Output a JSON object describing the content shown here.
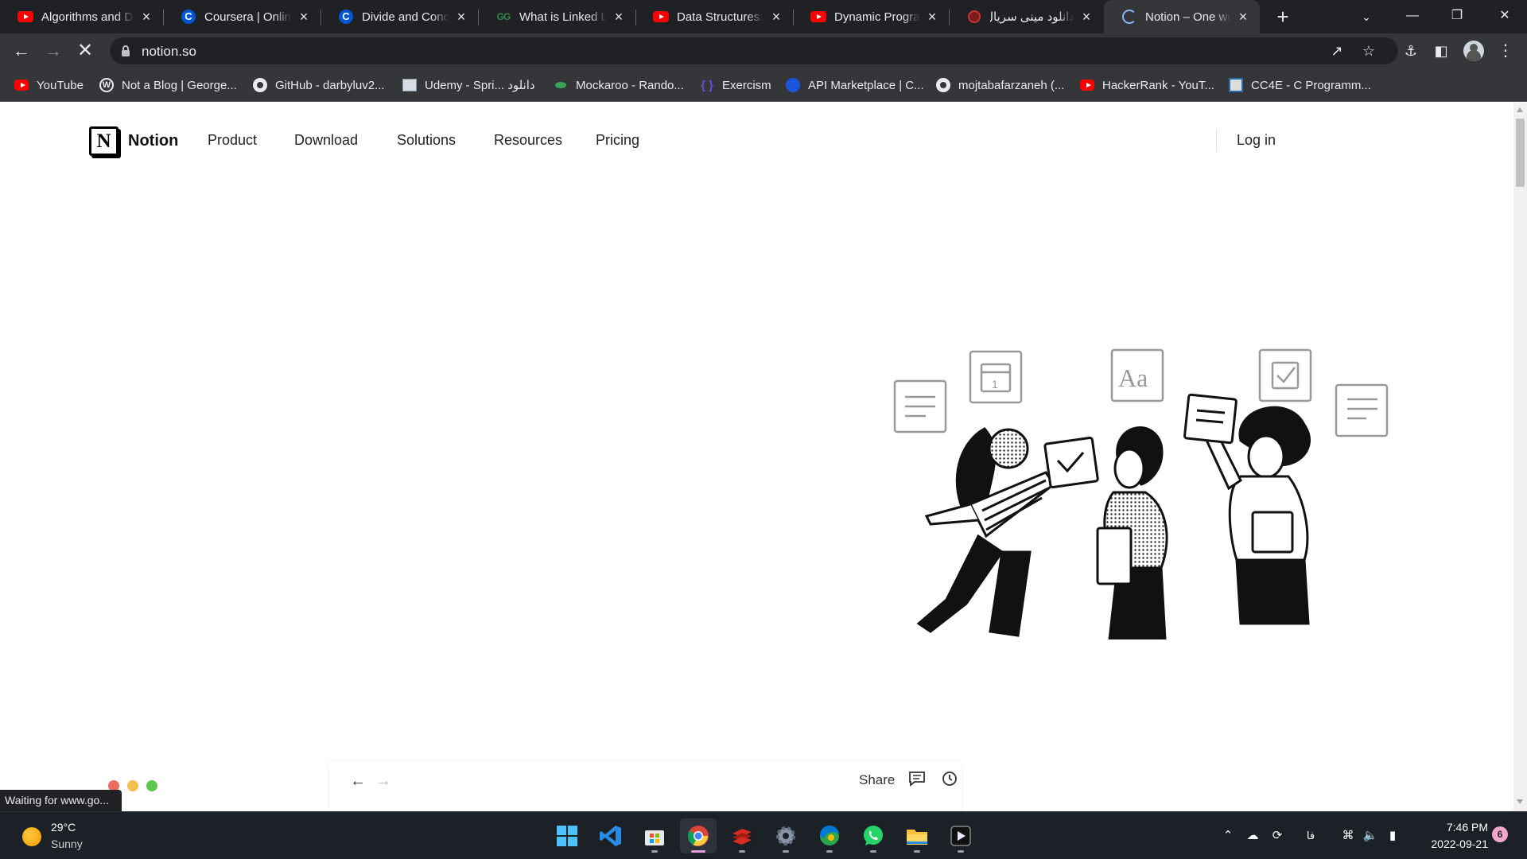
{
  "browser": {
    "tabs": [
      {
        "title": "Algorithms and Data Structures",
        "icon": "youtube-icon"
      },
      {
        "title": "Coursera | Online Courses",
        "icon": "coursera-icon"
      },
      {
        "title": "Divide and Conquer",
        "icon": "coursera-icon"
      },
      {
        "title": "What is Linked List",
        "icon": "geeksforgeeks-icon"
      },
      {
        "title": "Data Structures: Easy",
        "icon": "youtube-icon"
      },
      {
        "title": "Dynamic Programming",
        "icon": "youtube-icon"
      },
      {
        "title": "دانلود مینی سریال",
        "icon": "site-icon"
      },
      {
        "title": "Notion – One workspace",
        "icon": "loading-icon",
        "active": true
      }
    ],
    "new_tab_label": "+",
    "url": "notion.so",
    "bookmarks": [
      {
        "label": "YouTube",
        "icon": "youtube-icon"
      },
      {
        "label": "Not a Blog | George...",
        "icon": "wordpress-icon"
      },
      {
        "label": "GitHub - darbyluv2...",
        "icon": "github-icon"
      },
      {
        "label": "Udemy - Spri... دانلود",
        "icon": "udemy-icon"
      },
      {
        "label": "Mockaroo - Rando...",
        "icon": "mockaroo-icon"
      },
      {
        "label": "Exercism",
        "icon": "exercism-icon"
      },
      {
        "label": "API Marketplace | C...",
        "icon": "api-icon"
      },
      {
        "label": "mojtabafarzaneh (...",
        "icon": "github-icon"
      },
      {
        "label": "HackerRank - YouT...",
        "icon": "youtube-icon"
      },
      {
        "label": "CC4E - C Programm...",
        "icon": "cc4e-icon"
      }
    ],
    "status_text": "Waiting for www.go..."
  },
  "notion": {
    "brand": "Notion",
    "logo_letter": "N",
    "nav": [
      "Product",
      "Download",
      "Solutions",
      "Resources",
      "Pricing"
    ],
    "login": "Log in",
    "preview": {
      "share": "Share"
    }
  },
  "taskbar": {
    "weather": {
      "temp": "29°C",
      "condition": "Sunny"
    },
    "apps": [
      "start",
      "vscode",
      "store",
      "chrome",
      "redis",
      "settings",
      "edge-canary",
      "whatsapp",
      "file-explorer",
      "media-player"
    ],
    "lang": "فا",
    "time": "7:46 PM",
    "date": "2022-09-21",
    "notifications": "6"
  },
  "colors": {
    "tabstrip": "#202124",
    "toolbar": "#35363a",
    "taskbar": "#1c2027",
    "notion_text": "#111111"
  }
}
